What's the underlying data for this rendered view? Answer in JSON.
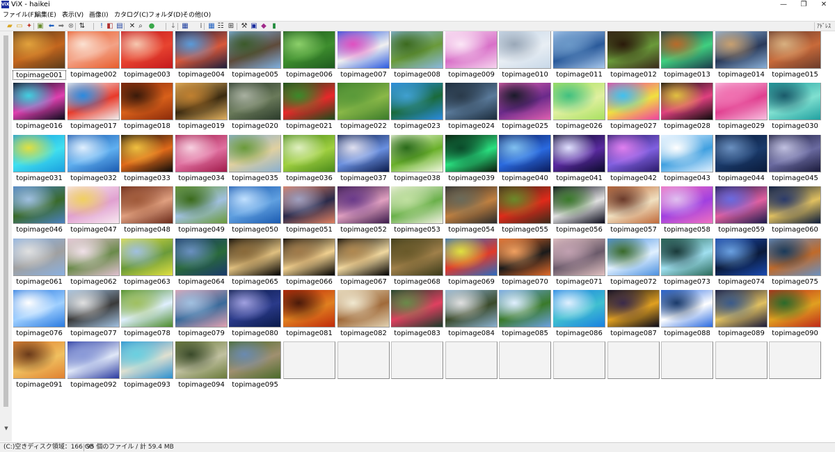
{
  "window": {
    "app_icon_text": "ViX",
    "title": "ViX - haikei"
  },
  "menu": [
    {
      "label": "ファイル(F)"
    },
    {
      "label": "編集(E)"
    },
    {
      "label": "表示(V)"
    },
    {
      "label": "画像(I)"
    },
    {
      "label": "カタログ(C)"
    },
    {
      "label": "フォルダ(D)"
    },
    {
      "label": "その他(O)"
    }
  ],
  "toolbar": {
    "address_label": "ｱﾄﾞﾚｽ",
    "buttons": [
      {
        "icon": "open-folder-icon",
        "glyph": "▰",
        "color": "#d9a520"
      },
      {
        "icon": "folder-icon",
        "glyph": "▭",
        "color": "#d9a520"
      },
      {
        "icon": "new-icon",
        "glyph": "✦",
        "color": "#c0392b"
      },
      {
        "icon": "image-folder-icon",
        "glyph": "▣",
        "color": "#6a8e2f"
      },
      {
        "icon": "back-icon",
        "glyph": "⬅",
        "color": "#1f5fbf"
      },
      {
        "icon": "forward-icon",
        "glyph": "➡",
        "color": "#777777"
      },
      {
        "icon": "stop-icon",
        "glyph": "⊗",
        "color": "#777777"
      },
      {
        "icon": "sort-icon",
        "glyph": "⇅",
        "color": "#222222"
      },
      {
        "icon": "mark-icon",
        "glyph": "!",
        "color": "#1f5fbf"
      },
      {
        "icon": "slideshow-icon",
        "glyph": "◧",
        "color": "#b03030"
      },
      {
        "icon": "info-icon",
        "glyph": "▤",
        "color": "#1f3f9f"
      },
      {
        "icon": "delete-icon",
        "glyph": "✕",
        "color": "#222222"
      },
      {
        "icon": "search-icon",
        "glyph": "⌕",
        "color": "#222222"
      },
      {
        "icon": "color-icon",
        "glyph": "●",
        "color": "#3aa84a"
      },
      {
        "icon": "down-icon",
        "glyph": "↓",
        "color": "#777777"
      },
      {
        "icon": "table-icon",
        "glyph": "▦",
        "color": "#1f3f9f"
      },
      {
        "icon": "details-icon",
        "glyph": "⁞",
        "color": "#333333"
      },
      {
        "icon": "thumbnail-view-icon",
        "glyph": "▦",
        "color": "#1f5fbf"
      },
      {
        "icon": "list-view-icon",
        "glyph": "☷",
        "color": "#333333"
      },
      {
        "icon": "grid-view-icon",
        "glyph": "⊞",
        "color": "#333333"
      },
      {
        "icon": "tool-icon",
        "glyph": "⚒",
        "color": "#333333"
      },
      {
        "icon": "vix-icon",
        "glyph": "▣",
        "color": "#1d2f9e"
      },
      {
        "icon": "eraser-icon",
        "glyph": "◆",
        "color": "#a02a8a"
      },
      {
        "icon": "bookmark-icon",
        "glyph": "▮",
        "color": "#1f8a3a"
      }
    ]
  },
  "thumbnails": [
    {
      "name": "topimage001",
      "colors": [
        "#5a3a1a",
        "#c4661e",
        "#e2a23c"
      ]
    },
    {
      "name": "topimage002",
      "colors": [
        "#e85c2c",
        "#f3a286",
        "#fbe1d2"
      ]
    },
    {
      "name": "topimage003",
      "colors": [
        "#c4181c",
        "#e84430",
        "#f6c8b0"
      ]
    },
    {
      "name": "topimage004",
      "colors": [
        "#1c1c3a",
        "#d8583a",
        "#5a9ad8"
      ]
    },
    {
      "name": "topimage005",
      "colors": [
        "#7fb0e0",
        "#5e4a3a",
        "#3c5a2a"
      ]
    },
    {
      "name": "topimage006",
      "colors": [
        "#1e5a1e",
        "#3e8e2e",
        "#8cd06a"
      ]
    },
    {
      "name": "topimage007",
      "colors": [
        "#2a5ae0",
        "#f0f0f0",
        "#e050c0"
      ]
    },
    {
      "name": "topimage008",
      "colors": [
        "#8ab8e0",
        "#6a9a3a",
        "#3c6a1e"
      ]
    },
    {
      "name": "topimage009",
      "colors": [
        "#f6d4ee",
        "#d870c8",
        "#fbe6f6"
      ]
    },
    {
      "name": "topimage010",
      "colors": [
        "#c8d8e8",
        "#e8eef4",
        "#9aa8b8"
      ]
    },
    {
      "name": "topimage011",
      "colors": [
        "#a8c8ec",
        "#2a5a9a",
        "#6a98c8"
      ]
    },
    {
      "name": "topimage012",
      "colors": [
        "#3a2a1a",
        "#6a9a3a",
        "#2a1a0a"
      ]
    },
    {
      "name": "topimage013",
      "colors": [
        "#1a3a4a",
        "#40d080",
        "#b86a2a"
      ]
    },
    {
      "name": "topimage014",
      "colors": [
        "#8ab0d8",
        "#2a3a5a",
        "#c8a070"
      ]
    },
    {
      "name": "topimage015",
      "colors": [
        "#6a3a2a",
        "#c86a3a",
        "#d8b080"
      ]
    },
    {
      "name": "topimage016",
      "colors": [
        "#0a0a1a",
        "#e040b0",
        "#40d0e0"
      ]
    },
    {
      "name": "topimage017",
      "colors": [
        "#f0f0f0",
        "#e83a2a",
        "#2a8ae0"
      ]
    },
    {
      "name": "topimage018",
      "colors": [
        "#8a2a0a",
        "#d8601a",
        "#3a1a0a"
      ]
    },
    {
      "name": "topimage019",
      "colors": [
        "#e0b060",
        "#3a2a10",
        "#c08030"
      ]
    },
    {
      "name": "topimage020",
      "colors": [
        "#2a3a2a",
        "#6a7a5a",
        "#a8b0a0"
      ]
    },
    {
      "name": "topimage021",
      "colors": [
        "#1a4a1a",
        "#e8282a",
        "#3a8a2a"
      ]
    },
    {
      "name": "topimage022",
      "colors": [
        "#3a7a2a",
        "#8ab848",
        "#5a9a3a"
      ]
    },
    {
      "name": "topimage023",
      "colors": [
        "#2a8ae0",
        "#1a6a3a",
        "#40a0d0"
      ]
    },
    {
      "name": "topimage024",
      "colors": [
        "#1a2a3a",
        "#5a7a9a",
        "#2a3a4a"
      ]
    },
    {
      "name": "topimage025",
      "colors": [
        "#e060b0",
        "#6a2a8a",
        "#1a1a2a"
      ]
    },
    {
      "name": "topimage026",
      "colors": [
        "#a8e060",
        "#e0f0a0",
        "#40c080"
      ]
    },
    {
      "name": "topimage027",
      "colors": [
        "#f040a0",
        "#f0e040",
        "#40c0f0"
      ]
    },
    {
      "name": "topimage028",
      "colors": [
        "#0a0a0a",
        "#e04080",
        "#e0c040"
      ]
    },
    {
      "name": "topimage029",
      "colors": [
        "#f8c0e0",
        "#e04090",
        "#f070b0"
      ]
    },
    {
      "name": "topimage030",
      "colors": [
        "#20a0a0",
        "#80e0d0",
        "#1a5a6a"
      ]
    },
    {
      "name": "topimage031",
      "colors": [
        "#1aa0e0",
        "#40e0f0",
        "#e0e040"
      ]
    },
    {
      "name": "topimage032",
      "colors": [
        "#1a5ab0",
        "#60b0f0",
        "#e0f0ff"
      ]
    },
    {
      "name": "topimage033",
      "colors": [
        "#0a0a0a",
        "#e06a1a",
        "#f0c040"
      ]
    },
    {
      "name": "topimage034",
      "colors": [
        "#a01a4a",
        "#e070a0",
        "#f8d0e0"
      ]
    },
    {
      "name": "topimage035",
      "colors": [
        "#8ab0d0",
        "#e0d0a0",
        "#6a9a3a"
      ]
    },
    {
      "name": "topimage036",
      "colors": [
        "#4a8a1a",
        "#a0d040",
        "#e0f0c0"
      ]
    },
    {
      "name": "topimage037",
      "colors": [
        "#0a1a4a",
        "#6a90e0",
        "#e0e0f0"
      ]
    },
    {
      "name": "topimage038",
      "colors": [
        "#f0f8e0",
        "#6ab02a",
        "#2a6a1a"
      ]
    },
    {
      "name": "topimage039",
      "colors": [
        "#0a1a0a",
        "#2ae080",
        "#0a4a2a"
      ]
    },
    {
      "name": "topimage040",
      "colors": [
        "#0a1a5a",
        "#2a6ae0",
        "#80c0f0"
      ]
    },
    {
      "name": "topimage041",
      "colors": [
        "#0a0a2a",
        "#5a2aa0",
        "#e0e0ff"
      ]
    },
    {
      "name": "topimage042",
      "colors": [
        "#2a1a6a",
        "#8060e0",
        "#e080f0"
      ]
    },
    {
      "name": "topimage043",
      "colors": [
        "#e0f0ff",
        "#40a0e0",
        "#ffffff"
      ]
    },
    {
      "name": "topimage044",
      "colors": [
        "#0a1a3a",
        "#1a3a6a",
        "#6a90c0"
      ]
    },
    {
      "name": "topimage045",
      "colors": [
        "#1a1a3a",
        "#6a6aa0",
        "#c0c0e0"
      ]
    },
    {
      "name": "topimage046",
      "colors": [
        "#4a80c0",
        "#3a6a2a",
        "#a0c0e0"
      ]
    },
    {
      "name": "topimage047",
      "colors": [
        "#f8e8f0",
        "#e0a0d0",
        "#f0d060"
      ]
    },
    {
      "name": "topimage048",
      "colors": [
        "#6a2a1a",
        "#e0a080",
        "#a05a3a"
      ]
    },
    {
      "name": "topimage049",
      "colors": [
        "#6a9a3a",
        "#a0c0e0",
        "#3a6a1a"
      ]
    },
    {
      "name": "topimage050",
      "colors": [
        "#1a5ab0",
        "#60a0e0",
        "#c0e0ff"
      ]
    },
    {
      "name": "topimage051",
      "colors": [
        "#e08060",
        "#2a2a4a",
        "#a0a0c0"
      ]
    },
    {
      "name": "topimage052",
      "colors": [
        "#3a1a4a",
        "#e0a0c0",
        "#6a3a8a"
      ]
    },
    {
      "name": "topimage053",
      "colors": [
        "#f0f0e0",
        "#6ab04a",
        "#c0e0a0"
      ]
    },
    {
      "name": "topimage054",
      "colors": [
        "#2a2a2a",
        "#c08040",
        "#6a6a5a"
      ]
    },
    {
      "name": "topimage055",
      "colors": [
        "#3a2a1a",
        "#e02a1a",
        "#6a8a2a"
      ]
    },
    {
      "name": "topimage056",
      "colors": [
        "#0a0a1a",
        "#e0e0e0",
        "#3a7a2a"
      ]
    },
    {
      "name": "topimage057",
      "colors": [
        "#c06a3a",
        "#f0e0c0",
        "#6a3a2a"
      ]
    },
    {
      "name": "topimage058",
      "colors": [
        "#f070c0",
        "#a040e0",
        "#e0c0f0"
      ]
    },
    {
      "name": "topimage059",
      "colors": [
        "#1a1a4a",
        "#e060a0",
        "#6a6ae0"
      ]
    },
    {
      "name": "topimage060",
      "colors": [
        "#0a1a3a",
        "#e0c060",
        "#2a3a6a"
      ]
    },
    {
      "name": "topimage061",
      "colors": [
        "#8ab0e0",
        "#a0a0a0",
        "#e0e0e0"
      ]
    },
    {
      "name": "topimage062",
      "colors": [
        "#e0c0d0",
        "#6a8a4a",
        "#f0e0e8"
      ]
    },
    {
      "name": "topimage063",
      "colors": [
        "#e0e040",
        "#6a9a3a",
        "#a0c0e0"
      ]
    },
    {
      "name": "topimage064",
      "colors": [
        "#1a3a6a",
        "#2a6a3a",
        "#6a90c0"
      ]
    },
    {
      "name": "topimage065",
      "colors": [
        "#000000",
        "#e0c080",
        "#8a6a3a"
      ]
    },
    {
      "name": "topimage066",
      "colors": [
        "#000000",
        "#f0d090",
        "#a07a4a"
      ]
    },
    {
      "name": "topimage067",
      "colors": [
        "#000000",
        "#f0d8a0",
        "#b08850"
      ]
    },
    {
      "name": "topimage068",
      "colors": [
        "#3a3a1a",
        "#a0804a",
        "#6a5a2a"
      ]
    },
    {
      "name": "topimage069",
      "colors": [
        "#2a6ac0",
        "#e03a2a",
        "#e0e040"
      ]
    },
    {
      "name": "topimage070",
      "colors": [
        "#e06a2a",
        "#1a1a1a",
        "#f0a060"
      ]
    },
    {
      "name": "topimage071",
      "colors": [
        "#e0c0c0",
        "#6a5a6a",
        "#c0a0b0"
      ]
    },
    {
      "name": "topimage072",
      "colors": [
        "#4a90e0",
        "#e0f0ff",
        "#3a6a2a"
      ]
    },
    {
      "name": "topimage073",
      "colors": [
        "#2a6a5a",
        "#a0e0f0",
        "#1a3a3a"
      ]
    },
    {
      "name": "topimage074",
      "colors": [
        "#1a4ab0",
        "#0a1a3a",
        "#6aa0e0"
      ]
    },
    {
      "name": "topimage075",
      "colors": [
        "#6a90c0",
        "#c06a2a",
        "#1a3a5a"
      ]
    },
    {
      "name": "topimage076",
      "colors": [
        "#2a7ae0",
        "#a0d0ff",
        "#ffffff"
      ]
    },
    {
      "name": "topimage077",
      "colors": [
        "#a0c0e0",
        "#3a3a3a",
        "#e0e0e0"
      ]
    },
    {
      "name": "topimage078",
      "colors": [
        "#4a8a2a",
        "#e0f0ff",
        "#a0c060"
      ]
    },
    {
      "name": "topimage079",
      "colors": [
        "#e0a0b0",
        "#3a6a9a",
        "#a0c0e0"
      ]
    },
    {
      "name": "topimage080",
      "colors": [
        "#0a1a4a",
        "#2a3a8a",
        "#a0a0e0"
      ]
    },
    {
      "name": "topimage081",
      "colors": [
        "#c02a0a",
        "#e08020",
        "#4a1a0a"
      ]
    },
    {
      "name": "topimage082",
      "colors": [
        "#e0d0b0",
        "#a06a3a",
        "#f0e8d0"
      ]
    },
    {
      "name": "topimage083",
      "colors": [
        "#1a3a2a",
        "#e04060",
        "#6a8a4a"
      ]
    },
    {
      "name": "topimage084",
      "colors": [
        "#8ab0d0",
        "#3a4a2a",
        "#e0e0e0"
      ]
    },
    {
      "name": "topimage085",
      "colors": [
        "#6aa0e0",
        "#3a7a2a",
        "#e0f0ff"
      ]
    },
    {
      "name": "topimage086",
      "colors": [
        "#1a80e0",
        "#40c0d0",
        "#e0f0ff"
      ]
    },
    {
      "name": "topimage087",
      "colors": [
        "#0a0a1a",
        "#e0a020",
        "#3a2a4a"
      ]
    },
    {
      "name": "topimage088",
      "colors": [
        "#2a6ae0",
        "#ffffff",
        "#1a3a6a"
      ]
    },
    {
      "name": "topimage089",
      "colors": [
        "#1a1a3a",
        "#e0c060",
        "#3a5a8a"
      ]
    },
    {
      "name": "topimage090",
      "colors": [
        "#c02a1a",
        "#e0a020",
        "#2a6a2a"
      ]
    },
    {
      "name": "topimage091",
      "colors": [
        "#e08030",
        "#f0c060",
        "#6a3a1a"
      ]
    },
    {
      "name": "topimage092",
      "colors": [
        "#2a3aa0",
        "#e0e8f8",
        "#8a9ad8"
      ]
    },
    {
      "name": "topimage093",
      "colors": [
        "#2a90d0",
        "#e0e0d0",
        "#6ad0e0"
      ]
    },
    {
      "name": "topimage094",
      "colors": [
        "#6a7a3a",
        "#c0c0a0",
        "#3a4a2a"
      ]
    },
    {
      "name": "topimage095",
      "colors": [
        "#4a6a2a",
        "#a09070",
        "#6a8ab0"
      ]
    }
  ],
  "selected_thumbnail": "topimage001",
  "status": {
    "disk_free": "(C:)空きディスク領域：166 GB",
    "file_count": "95 個のファイル / 計 59.4 MB"
  }
}
